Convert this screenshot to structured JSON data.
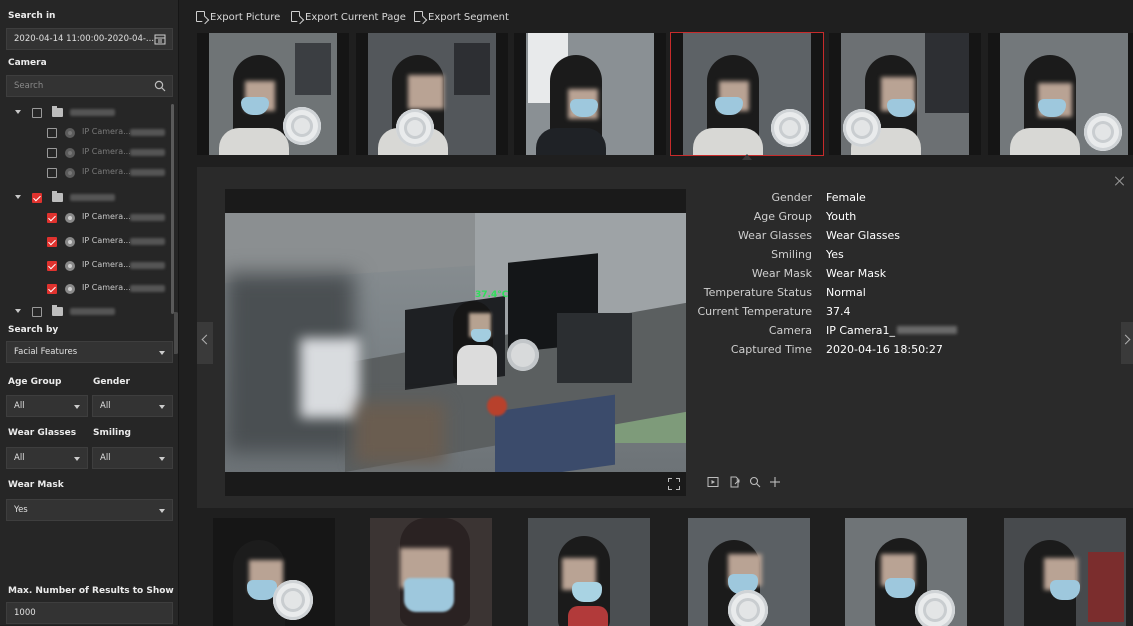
{
  "left": {
    "search_in_label": "Search in",
    "date_range": "2020-04-14 11:00:00-2020-04-...",
    "camera_label": "Camera",
    "camera_search_placeholder": "Search",
    "tree": [
      {
        "kind": "group",
        "checked": false,
        "label": "172.7.31.101"
      },
      {
        "kind": "camera",
        "checked": false,
        "label": "IP Camera...",
        "dim": true
      },
      {
        "kind": "camera",
        "checked": false,
        "label": "IP Camera...",
        "dim": true
      },
      {
        "kind": "camera",
        "checked": false,
        "label": "IP Camera...",
        "dim": true
      },
      {
        "kind": "group",
        "checked": true,
        "label": "172.7.15.189"
      },
      {
        "kind": "camera",
        "checked": true,
        "label": "IP Camera..."
      },
      {
        "kind": "camera",
        "checked": true,
        "label": "IP Camera..."
      },
      {
        "kind": "camera",
        "checked": true,
        "label": "IP Camera..."
      },
      {
        "kind": "camera",
        "checked": true,
        "label": "IP Camera..."
      },
      {
        "kind": "group",
        "checked": false,
        "label": "172.7.15.179"
      }
    ],
    "search_by_label": "Search by",
    "search_by_value": "Facial Features",
    "age_group_label": "Age Group",
    "age_group_value": "All",
    "gender_label": "Gender",
    "gender_value": "All",
    "wear_glasses_label": "Wear Glasses",
    "wear_glasses_value": "All",
    "smiling_label": "Smiling",
    "smiling_value": "All",
    "wear_mask_label": "Wear Mask",
    "wear_mask_value": "Yes",
    "max_results_label": "Max. Number of Results to Show",
    "max_results_value": "1000"
  },
  "toolbar": {
    "export_picture": "Export Picture",
    "export_current_page": "Export Current Page",
    "export_segment": "Export Segment"
  },
  "detail": {
    "temperature_overlay": "37.4°C",
    "rows": [
      {
        "label": "Gender",
        "value": "Female"
      },
      {
        "label": "Age Group",
        "value": "Youth"
      },
      {
        "label": "Wear Glasses",
        "value": "Wear Glasses"
      },
      {
        "label": "Smiling",
        "value": "Yes"
      },
      {
        "label": "Wear Mask",
        "value": "Wear Mask"
      },
      {
        "label": "Temperature Status",
        "value": "Normal"
      },
      {
        "label": "Current Temperature",
        "value": "37.4"
      },
      {
        "label": "Camera",
        "value": "IP Camera1_"
      },
      {
        "label": "Captured Time",
        "value": "2020-04-16 18:50:27"
      }
    ]
  },
  "colors": {
    "accent_red": "#e0322e",
    "temperature_green": "#2ee05a"
  }
}
